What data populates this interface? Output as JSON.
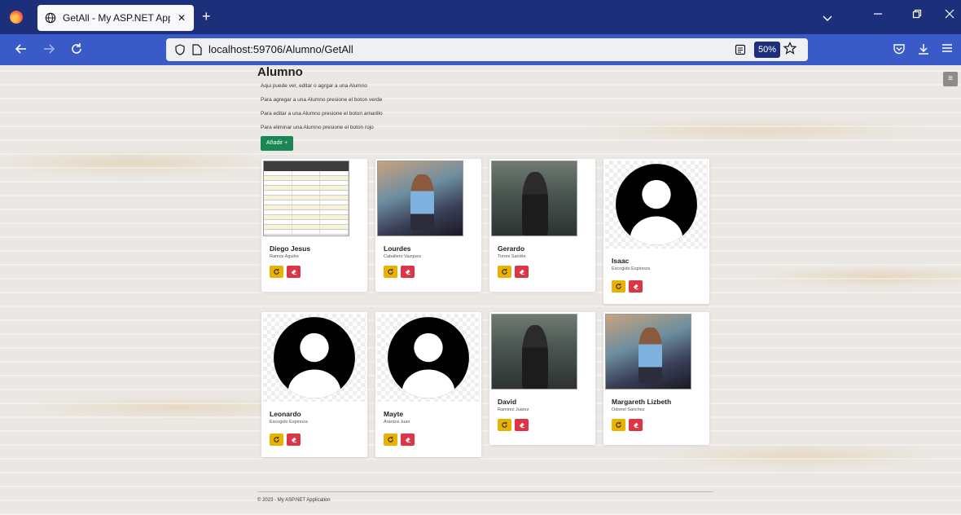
{
  "browser": {
    "tab_title": "GetAll - My ASP.NET Applicatio",
    "tab_close": "✕",
    "new_tab": "+",
    "url": "localhost:59706/Alumno/GetAll",
    "zoom": "50%",
    "icons": [
      "firefox-logo",
      "globe-icon",
      "back-icon",
      "forward-icon",
      "reload-icon",
      "shield-icon",
      "page-icon",
      "reader-icon",
      "star-icon",
      "pocket-icon",
      "download-icon",
      "menu-icon"
    ]
  },
  "page": {
    "title": "Alumno",
    "lines": [
      "Aqui puede ver, editar o agrgar a una Alumno",
      "Para agregar a una Alumno presione el boton verde",
      "Para editar a una Alumno presione el boton amarillo",
      "Para eliminar una Alumno presione el boton rojo"
    ],
    "add_label": "Añadir +",
    "footer": "© 2023 - My ASP.NET Application"
  },
  "students": [
    {
      "name": "Diego Jesus",
      "surname": "Ramos Aguilre",
      "photo": "document"
    },
    {
      "name": "Lourdes",
      "surname": "Caballero Vazques",
      "photo": "portrait-woman"
    },
    {
      "name": "Gerardo",
      "surname": "Torres Sandre",
      "photo": "portrait-man"
    },
    {
      "name": "Isaac",
      "surname": "Escogido Espinoza",
      "photo": "default-avatar"
    },
    {
      "name": "Leonardo",
      "surname": "Escogido Espinoza",
      "photo": "default-avatar"
    },
    {
      "name": "Mayte",
      "surname": "Arantza Juan",
      "photo": "default-avatar"
    },
    {
      "name": "David",
      "surname": "Ramirez Juarez",
      "photo": "portrait-man"
    },
    {
      "name": "Margareth Lizbeth",
      "surname": "Odonel Sanchez",
      "photo": "portrait-woman"
    }
  ],
  "colors": {
    "add": "#198754",
    "edit": "#e9b200",
    "delete": "#dc3545",
    "tabbar": "#1c2f7a",
    "navbar": "#3a5bc7"
  }
}
